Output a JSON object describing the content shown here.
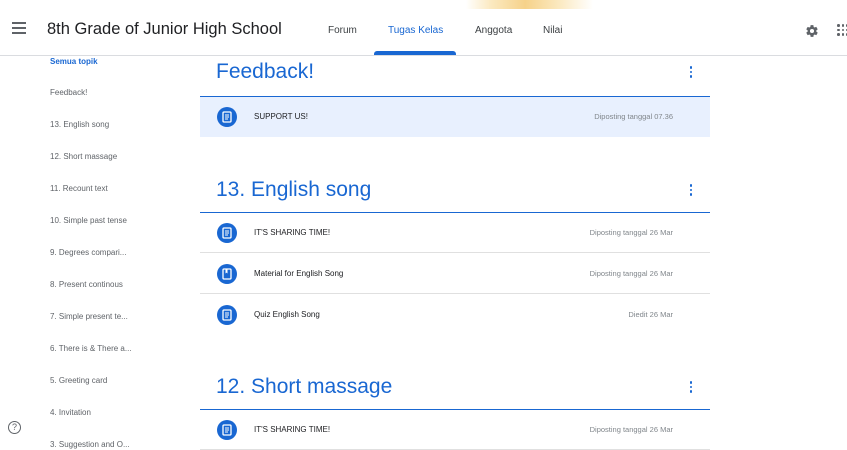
{
  "header": {
    "class_title": "8th Grade of Junior High School",
    "tabs": [
      {
        "label": "Forum"
      },
      {
        "label": "Tugas Kelas"
      },
      {
        "label": "Anggota"
      },
      {
        "label": "Nilai"
      }
    ],
    "active_tab": "Tugas Kelas",
    "icons": [
      "menu-icon",
      "gear-icon",
      "apps-icon"
    ]
  },
  "sidebar": {
    "items": [
      {
        "label": "Semua topik"
      },
      {
        "label": "Feedback!"
      },
      {
        "label": "13. English song"
      },
      {
        "label": "12. Short massage"
      },
      {
        "label": "11. Recount text"
      },
      {
        "label": "10. Simple past tense"
      },
      {
        "label": "9. Degrees compari..."
      },
      {
        "label": "8. Present continous"
      },
      {
        "label": "7. Simple present te..."
      },
      {
        "label": "6. There is & There a..."
      },
      {
        "label": "5. Greeting card"
      },
      {
        "label": "4. Invitation"
      },
      {
        "label": "3. Suggestion and O..."
      }
    ],
    "help_label": "?"
  },
  "topics": [
    {
      "title": "Feedback!",
      "items": [
        {
          "name": "SUPPORT US!",
          "meta": "Diposting tanggal 07.36",
          "icon": "assignment-icon"
        }
      ]
    },
    {
      "title": "13. English song",
      "items": [
        {
          "name": "IT'S SHARING TIME!",
          "meta": "Diposting tanggal 26 Mar",
          "icon": "assignment-icon"
        },
        {
          "name": "Material for English Song",
          "meta": "Diposting tanggal 26 Mar",
          "icon": "material-icon"
        },
        {
          "name": "Quiz English Song",
          "meta": "Diedit 26 Mar",
          "icon": "assignment-icon"
        }
      ]
    },
    {
      "title": "12. Short massage",
      "items": [
        {
          "name": "IT'S SHARING TIME!",
          "meta": "Diposting tanggal 26 Mar",
          "icon": "assignment-icon"
        }
      ]
    }
  ],
  "colors": {
    "accent": "#1967d2",
    "highlight": "#e8f0fe",
    "text": "#3c4043",
    "muted": "#5f6368"
  }
}
